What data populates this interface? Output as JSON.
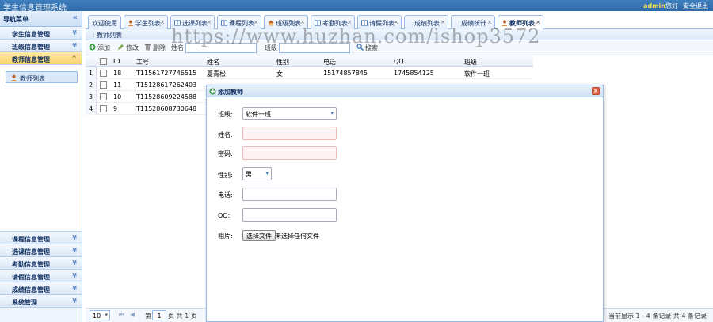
{
  "app": {
    "title": "学生信息管理系统",
    "user": "admin",
    "greeting": "您好",
    "logout": "安全退出"
  },
  "sidebar": {
    "header": "导航菜单",
    "collapse_icon": "double-left-chevron",
    "top_menus": [
      {
        "label": "学生信息管理"
      },
      {
        "label": "班级信息管理"
      },
      {
        "label": "教师信息管理"
      }
    ],
    "active_sub_item": "教师列表",
    "bottom_menus": [
      {
        "label": "课程信息管理"
      },
      {
        "label": "选课信息管理"
      },
      {
        "label": "考勤信息管理"
      },
      {
        "label": "请假信息管理"
      },
      {
        "label": "成绩信息管理"
      },
      {
        "label": "系统管理"
      }
    ]
  },
  "tabs": [
    {
      "label": "欢迎使用"
    },
    {
      "label": "学生列表"
    },
    {
      "label": "选课列表"
    },
    {
      "label": "课程列表"
    },
    {
      "label": "班级列表"
    },
    {
      "label": "考勤列表"
    },
    {
      "label": "请假列表"
    },
    {
      "label": "成绩列表"
    },
    {
      "label": "成绩统计"
    },
    {
      "label": "教师列表"
    }
  ],
  "panel": {
    "title": "教师列表",
    "toolbar": {
      "add": "添加",
      "edit": "修改",
      "delete": "删除",
      "name_label": "姓名",
      "class_label": "班级",
      "search": "搜索"
    }
  },
  "grid": {
    "columns": [
      "ID",
      "工号",
      "姓名",
      "性别",
      "电话",
      "QQ",
      "班级"
    ],
    "rows": [
      {
        "n": "1",
        "id": "18",
        "no": "T11561727746515",
        "name": "夏青松",
        "sex": "女",
        "phone": "15174857845",
        "qq": "1745854125",
        "cls": "软件一班"
      },
      {
        "n": "2",
        "id": "11",
        "no": "T15128617262403",
        "name": "",
        "sex": "",
        "phone": "",
        "qq": "",
        "cls": ""
      },
      {
        "n": "3",
        "id": "10",
        "no": "T11528609224588",
        "name": "",
        "sex": "",
        "phone": "",
        "qq": "",
        "cls": ""
      },
      {
        "n": "4",
        "id": "9",
        "no": "T11528608730648",
        "name": "",
        "sex": "",
        "phone": "",
        "qq": "",
        "cls": ""
      }
    ]
  },
  "pager": {
    "page_size": "10",
    "page_prefix": "第",
    "current_page": "1",
    "page_suffix": "页 共 1 页",
    "info": "当前显示 1 - 4 条记录 共 4 条记录"
  },
  "dialog": {
    "title": "添加教师",
    "class_label": "班级:",
    "class_value": "软件一班",
    "name_label": "姓名:",
    "password_label": "密码:",
    "sex_label": "性别:",
    "sex_value": "男",
    "phone_label": "电话:",
    "qq_label": "QQ:",
    "photo_label": "相片:",
    "choose_file": "选择文件",
    "no_file": "未选择任何文件"
  },
  "watermark": "https://www.huzhan.com/ishop3572"
}
